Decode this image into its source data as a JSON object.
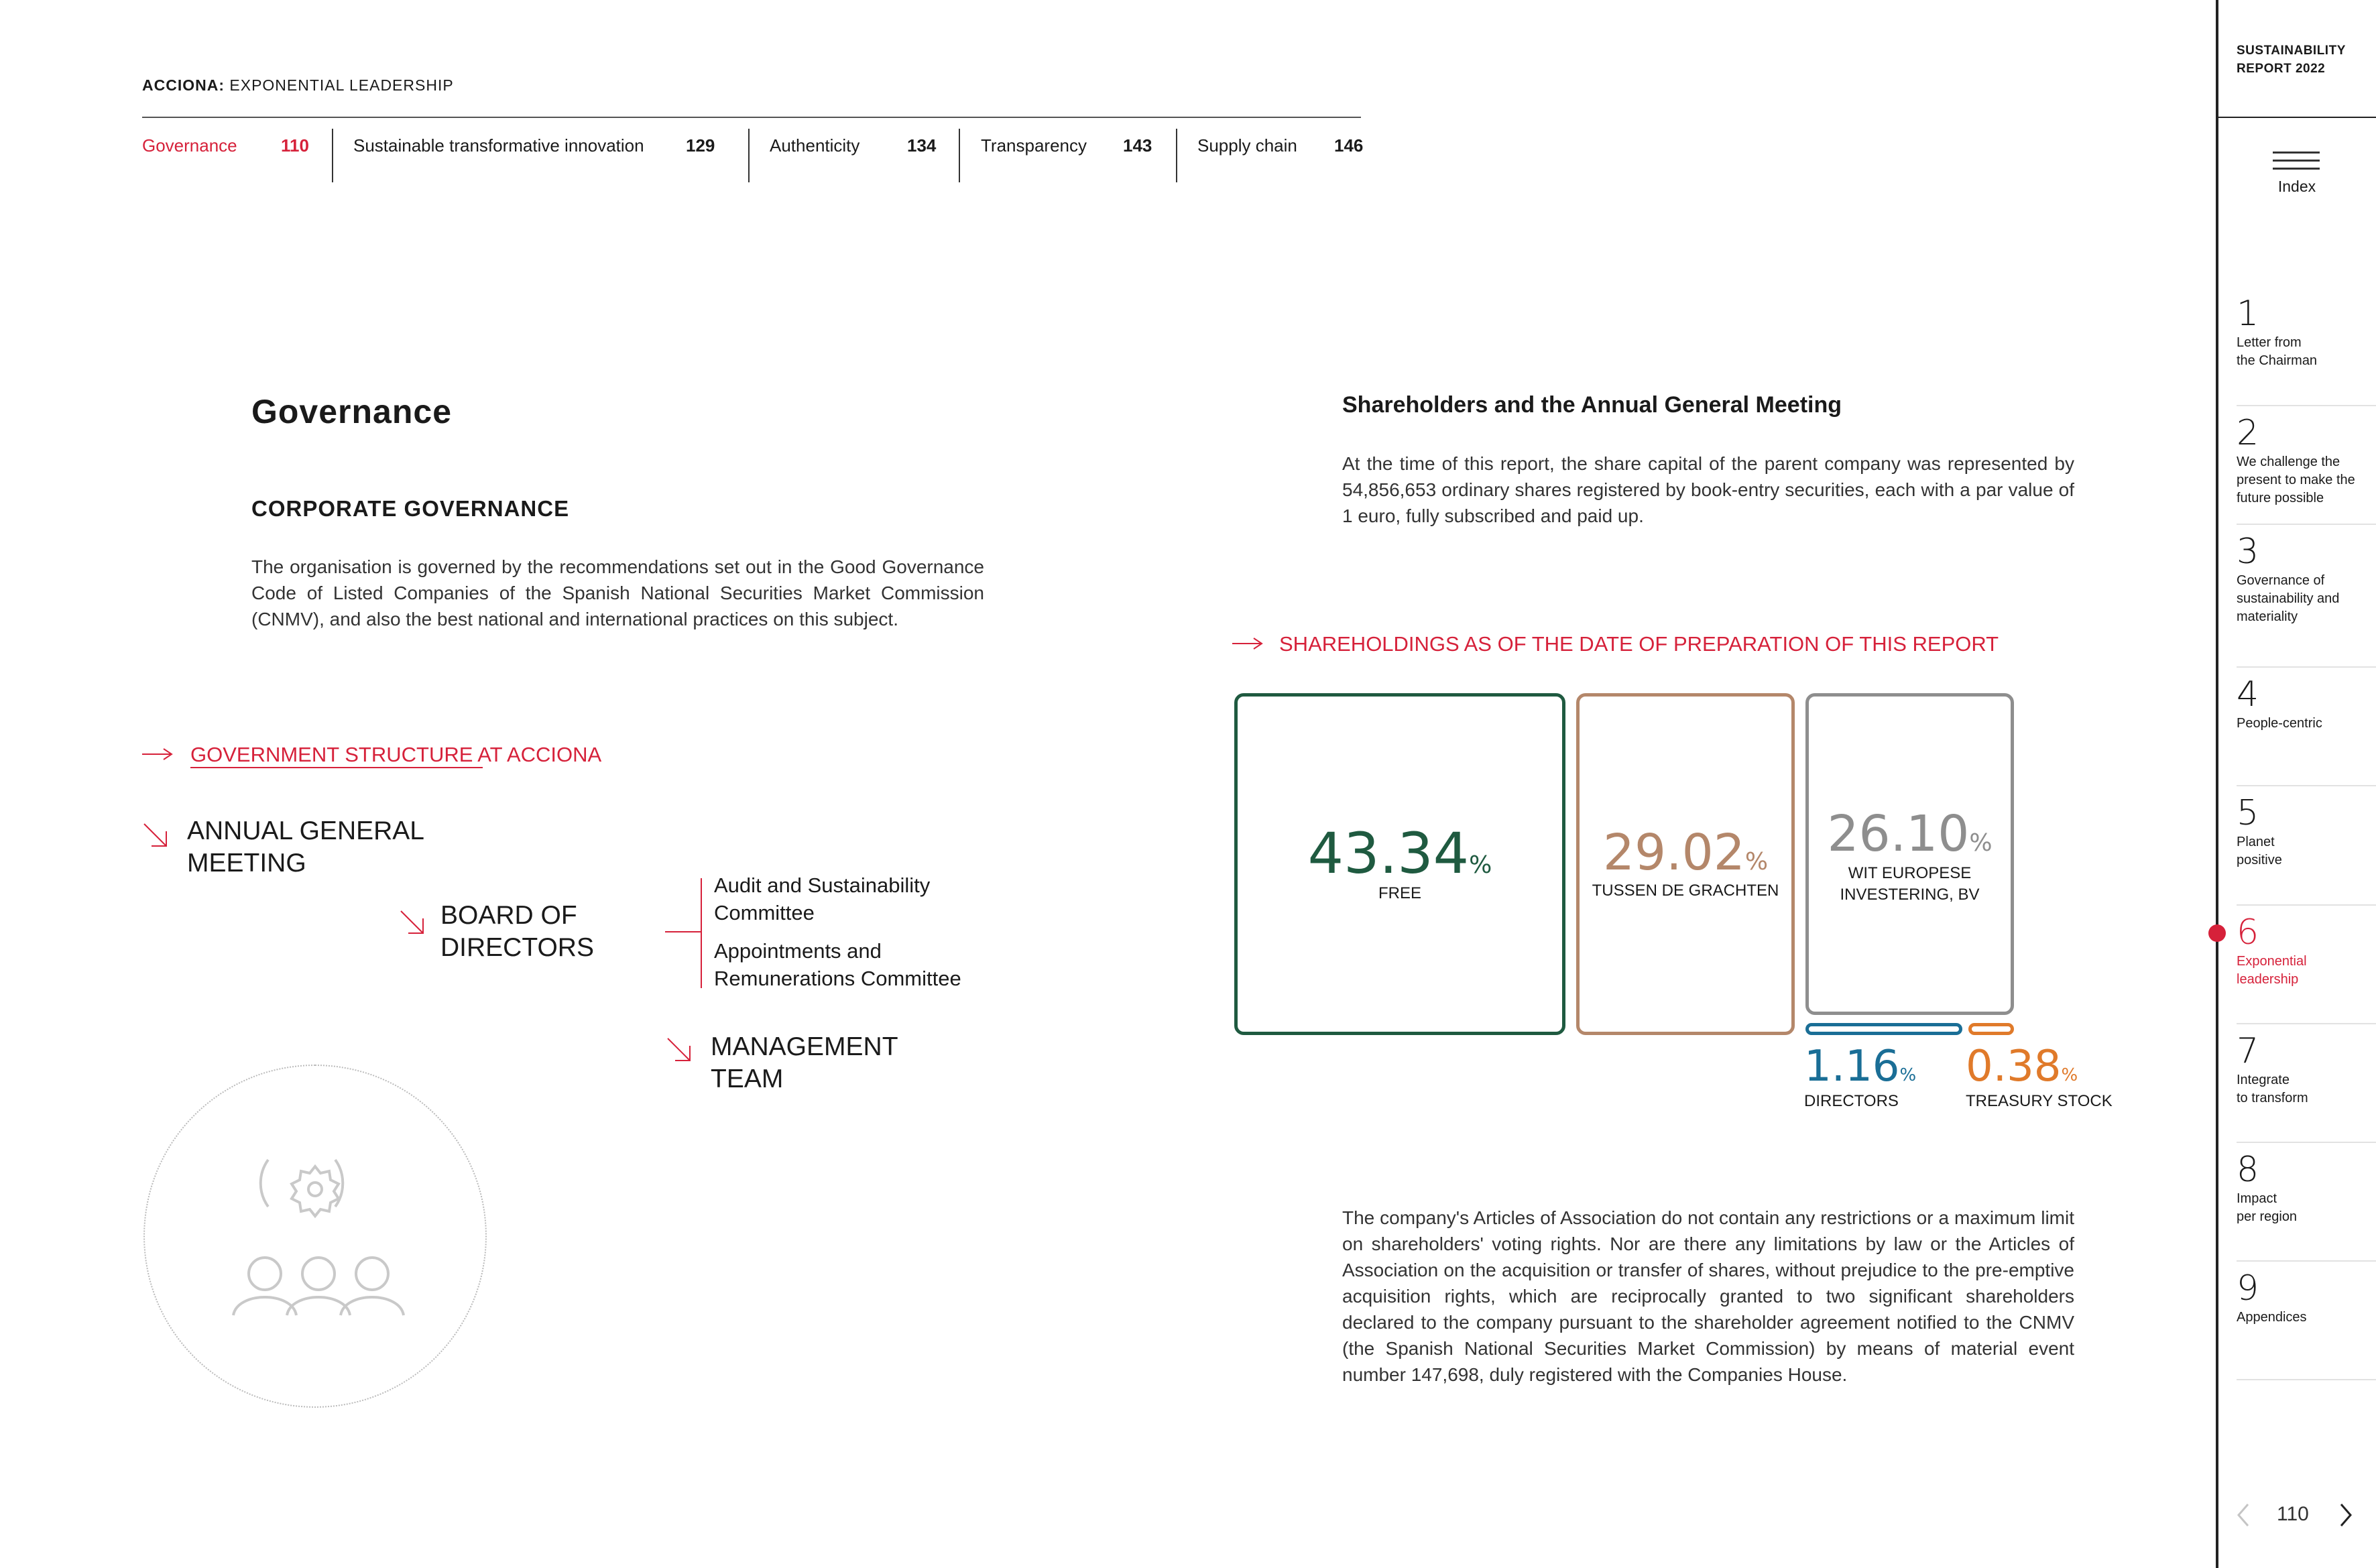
{
  "header": {
    "brand_bold": "ACCIONA:",
    "brand_rest": " EXPONENTIAL LEADERSHIP",
    "sections": [
      {
        "label": "Governance",
        "page": "110",
        "active": true
      },
      {
        "label": "Sustainable transformative innovation",
        "page": "129"
      },
      {
        "label": "Authenticity",
        "page": "134"
      },
      {
        "label": "Transparency",
        "page": "143"
      },
      {
        "label": "Supply chain",
        "page": "146"
      }
    ]
  },
  "sidebar": {
    "report_line1": "SUSTAINABILITY",
    "report_line2": "REPORT 2022",
    "index_label": "Index",
    "items": [
      {
        "num": "1",
        "l1": "Letter from",
        "l2": "the Chairman",
        "l3": ""
      },
      {
        "num": "2",
        "l1": "We challenge the",
        "l2": "present to make the",
        "l3": "future possible"
      },
      {
        "num": "3",
        "l1": "Governance of",
        "l2": "sustainability and",
        "l3": "materiality"
      },
      {
        "num": "4",
        "l1": "People-centric",
        "l2": "",
        "l3": ""
      },
      {
        "num": "5",
        "l1": "Planet",
        "l2": "positive",
        "l3": ""
      },
      {
        "num": "6",
        "l1": "Exponential",
        "l2": "leadership",
        "l3": "",
        "active": true
      },
      {
        "num": "7",
        "l1": "Integrate",
        "l2": "to transform",
        "l3": ""
      },
      {
        "num": "8",
        "l1": "Impact",
        "l2": "per region",
        "l3": ""
      },
      {
        "num": "9",
        "l1": "Appendices",
        "l2": "",
        "l3": ""
      }
    ],
    "page_number": "110",
    "accent": "#d6213a"
  },
  "left": {
    "title": "Governance",
    "subtitle": "CORPORATE GOVERNANCE",
    "body": "The organisation is governed by the recommendations set out in the Good Governance Code of Listed Companies of the Spanish National Securities Market Commission (CNMV), and also the best national and international practices on this subject.",
    "structure_heading": "GOVERNMENT STRUCTURE AT ACCIONA",
    "agm_l1": "ANNUAL GENERAL",
    "agm_l2": "MEETING",
    "board_l1": "BOARD OF",
    "board_l2": "DIRECTORS",
    "committee1_l1": "Audit and Sustainability",
    "committee1_l2": "Committee",
    "committee2_l1": "Appointments and",
    "committee2_l2": "Remunerations Committee",
    "mgmt_l1": "MANAGEMENT",
    "mgmt_l2": "TEAM",
    "icon_name": "gear-people-icon"
  },
  "right": {
    "title": "Shareholders and the Annual General Meeting",
    "body": "At the time of this report, the share capital of the parent company was represented by 54,856,653 ordinary shares registered by book-entry securities, each with a par value of 1 euro, fully subscribed and paid up.",
    "chart_heading": "SHAREHOLDINGS AS OF THE DATE OF PREPARATION OF THIS REPORT",
    "articles": "The company's Articles of Association do not contain any restrictions or a maximum limit on shareholders' voting rights. Nor are there any limitations by law or the Articles of Association on the acquisition or transfer of shares, without prejudice to the pre-emptive acquisition rights, which are reciprocally granted to two significant shareholders declared to the company pursuant to the shareholder agreement notified to the CNMV (the Spanish National Securities Market Commission) by means of material event number 147,698, duly registered with the Companies House."
  },
  "chart_data": {
    "type": "treemap",
    "title": "SHAREHOLDINGS AS OF THE DATE OF PREPARATION OF THIS REPORT",
    "unit": "%",
    "items": [
      {
        "label": "FREE",
        "value": 43.34,
        "display": "43.34",
        "color": "#1f5a40"
      },
      {
        "label": "TUSSEN DE GRACHTEN",
        "value": 29.02,
        "display": "29.02",
        "color": "#b4876a"
      },
      {
        "label_l1": "WIT EUROPESE",
        "label_l2": "INVESTERING, BV",
        "value": 26.1,
        "display": "26.10",
        "color": "#8e8e8e"
      },
      {
        "label": "DIRECTORS",
        "value": 1.16,
        "display": "1.16",
        "color": "#1a6e96"
      },
      {
        "label": "TREASURY STOCK",
        "value": 0.38,
        "display": "0.38",
        "color": "#e07a2a"
      }
    ]
  }
}
